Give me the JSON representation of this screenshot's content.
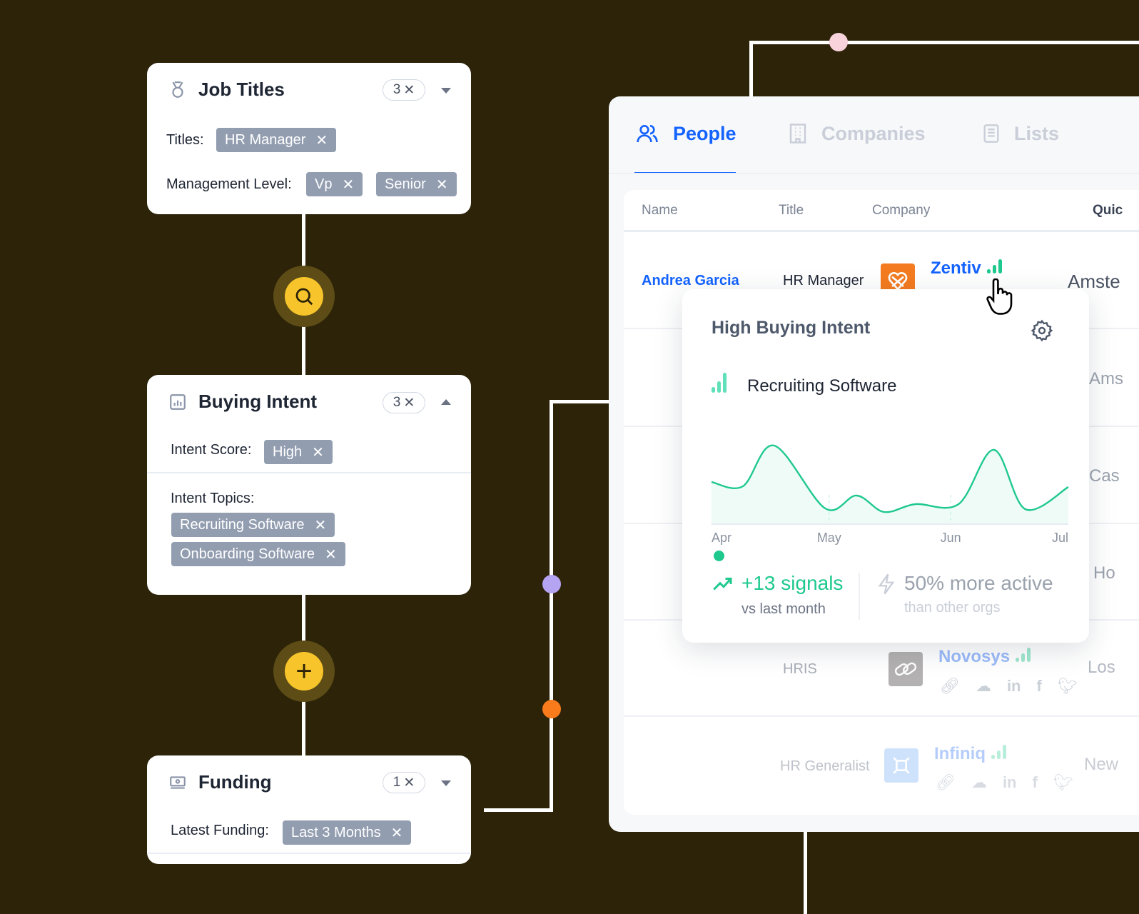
{
  "filters": {
    "job_titles": {
      "title": "Job Titles",
      "count": "3",
      "titles_label": "Titles:",
      "titles": [
        "HR Manager"
      ],
      "mgmt_label": "Management Level:",
      "mgmt": [
        "Vp",
        "Senior"
      ]
    },
    "buying_intent": {
      "title": "Buying Intent",
      "count": "3",
      "score_label": "Intent Score:",
      "score": [
        "High"
      ],
      "topics_label": "Intent Topics:",
      "topics": [
        "Recruiting Software",
        "Onboarding Software"
      ]
    },
    "funding": {
      "title": "Funding",
      "count": "1",
      "latest_label": "Latest Funding:",
      "latest": [
        "Last 3 Months"
      ]
    }
  },
  "tabs": [
    {
      "label": "People",
      "active": true
    },
    {
      "label": "Companies"
    },
    {
      "label": "Lists"
    }
  ],
  "table": {
    "headers": [
      "Name",
      "Title",
      "Company",
      "Quic"
    ],
    "rows": [
      {
        "name": "Andrea Garcia",
        "title": "HR Manager",
        "company": "Zentiv",
        "location": "Amste",
        "logo_color": "#f47b20"
      },
      {
        "location": "Ams"
      },
      {
        "location": "Cas"
      },
      {
        "location": "Ho"
      },
      {
        "title": "HRIS",
        "company": "Novosys",
        "location": "Los",
        "logo_color": "#9a9797"
      },
      {
        "title": "HR Generalist",
        "company": "Infiniq",
        "location": "New",
        "logo_color": "#a8ccfb"
      }
    ]
  },
  "popover": {
    "title": "High Buying Intent",
    "topic": "Recruiting Software",
    "signals": "+13 signals",
    "signals_sub": "vs last month",
    "activity": "50% more active",
    "activity_sub": "than other orgs"
  },
  "chart_data": {
    "type": "area",
    "x_ticks": [
      "Apr",
      "May",
      "Jun",
      "Jul"
    ],
    "x": [
      "2024-04-01",
      "2024-04-09",
      "2024-04-17",
      "2024-04-30",
      "2024-05-08",
      "2024-05-15",
      "2024-05-23",
      "2024-06-03",
      "2024-06-12",
      "2024-06-20",
      "2024-07-01"
    ],
    "values": [
      58,
      52,
      109,
      21,
      39,
      16,
      27,
      27,
      103,
      20,
      51
    ],
    "grid": false,
    "color": "#1fc98e"
  },
  "colors": {
    "background": "#2c2308",
    "accent": "#1463ff",
    "intent_green": "#1fc98e",
    "chip": "#929db0",
    "node_yellow": "#f7c52b",
    "dot_purple": "#b5a4f2",
    "dot_orange": "#f97b1b",
    "dot_pink": "#f9d3dc"
  }
}
